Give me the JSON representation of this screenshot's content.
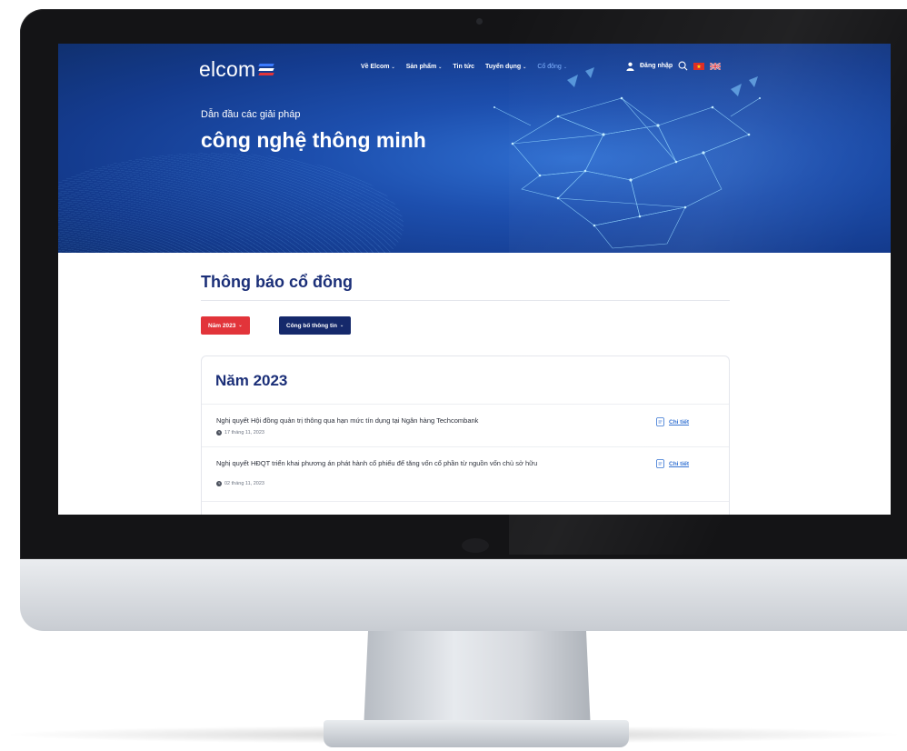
{
  "nav": {
    "logo_text": "elcom",
    "menu": [
      {
        "label": "Về Elcom",
        "caret": "⌄",
        "active": false
      },
      {
        "label": "Sản phẩm",
        "caret": "⌄",
        "active": false
      },
      {
        "label": "Tin tức",
        "caret": "",
        "active": false
      },
      {
        "label": "Tuyển dụng",
        "caret": "⌄",
        "active": false
      },
      {
        "label": "Cổ đông",
        "caret": "⌄",
        "active": true
      }
    ],
    "login_label": "Đăng nhập",
    "icons": {
      "user": "user-icon",
      "search": "search-icon",
      "flag_vi": "vietnam-flag-icon",
      "flag_en": "uk-flag-icon"
    }
  },
  "hero": {
    "tagline": "Dẫn đầu các giải pháp",
    "headline": "công nghệ thông minh"
  },
  "page": {
    "title": "Thông báo cổ đông",
    "year_filter": "Năm 2023",
    "type_filter": "Công bố thông tin",
    "filter_caret": "⌄"
  },
  "card": {
    "title": "Năm 2023",
    "items": [
      {
        "title": "Nghị quyết Hội đồng quản trị thông qua hạn mức tín dụng tại Ngân hàng Techcombank",
        "date": "17 tháng 11, 2023",
        "detail": "Chi tiết"
      },
      {
        "title": "Nghị quyết HĐQT triển khai phương án phát hành cổ phiếu để tăng vốn cổ phần từ nguồn vốn chủ sở hữu",
        "date": "02 tháng 11, 2023",
        "detail": "Chi tiết"
      }
    ]
  },
  "colors": {
    "hero_blue": "#1d4fae",
    "title_navy": "#1b2f78",
    "button_red": "#e2343a",
    "button_navy": "#15296b",
    "link_blue": "#2f6fd1",
    "logo_blue": "#3b7bff",
    "logo_red": "#e2343a"
  }
}
